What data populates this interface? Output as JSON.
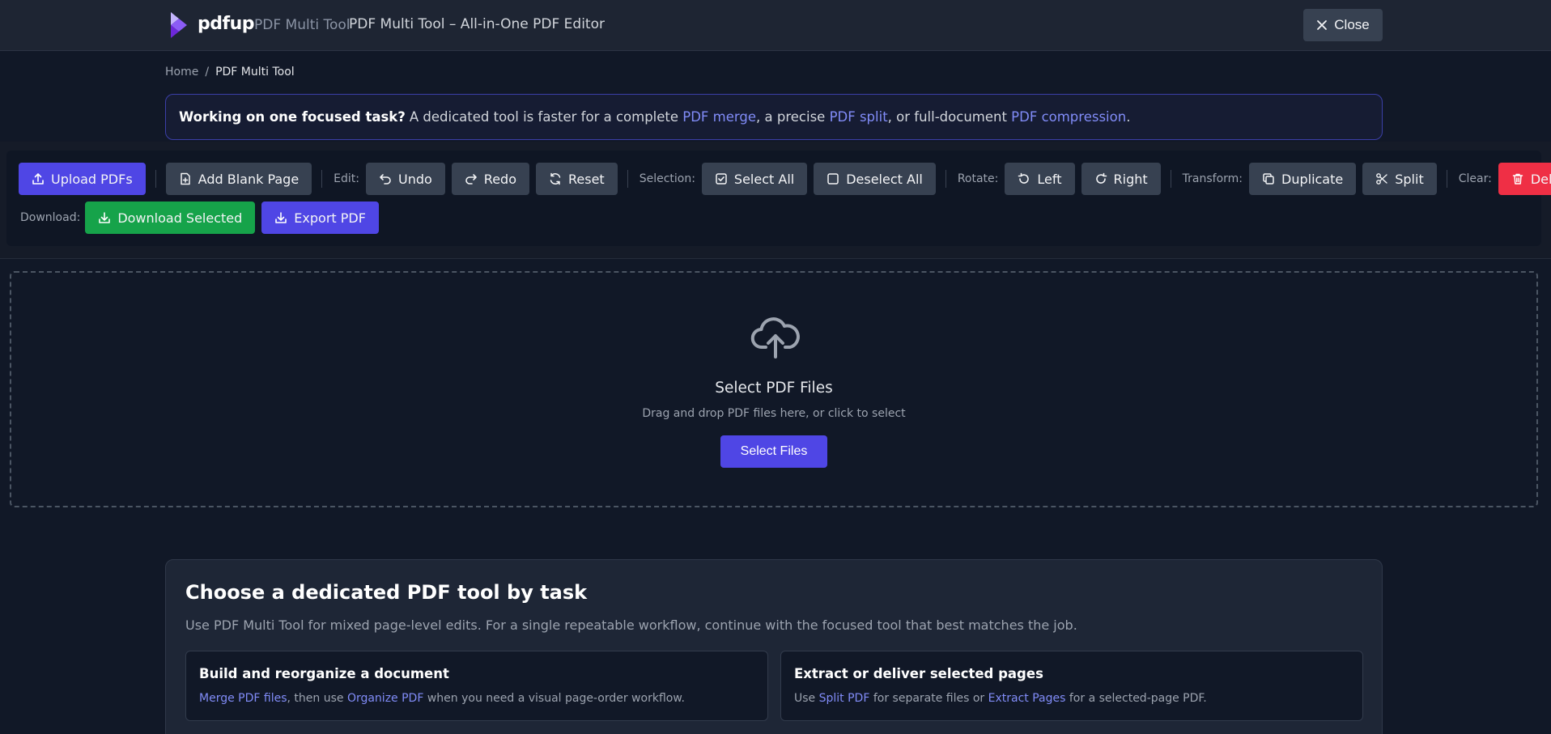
{
  "header": {
    "brand": "pdfup",
    "brand_sub": "PDF Multi Tool",
    "title": "PDF Multi Tool – All-in-One PDF Editor",
    "close_label": "Close"
  },
  "breadcrumb": {
    "home": "Home",
    "separator": "/",
    "current": "PDF Multi Tool"
  },
  "notice": {
    "lead": "Working on one focused task?",
    "text1": "A dedicated tool is faster for a complete ",
    "link1": "PDF merge",
    "text2": ", a precise ",
    "link2": "PDF split",
    "text3": ", or full-document ",
    "link3": "PDF compression",
    "text4": "."
  },
  "toolbar": {
    "upload": "Upload PDFs",
    "add_blank": "Add Blank Page",
    "edit_label": "Edit:",
    "undo": "Undo",
    "redo": "Redo",
    "reset": "Reset",
    "selection_label": "Selection:",
    "select_all": "Select All",
    "deselect_all": "Deselect All",
    "rotate_label": "Rotate:",
    "left": "Left",
    "right": "Right",
    "transform_label": "Transform:",
    "duplicate": "Duplicate",
    "split": "Split",
    "clear_label": "Clear:",
    "delete": "Delete",
    "download_label": "Download:",
    "download_selected": "Download Selected",
    "export": "Export PDF"
  },
  "dropzone": {
    "icon": "cloud-upload-icon",
    "title": "Select PDF Files",
    "subtitle": "Drag and drop PDF files here, or click to select",
    "button": "Select Files"
  },
  "tools": {
    "title": "Choose a dedicated PDF tool by task",
    "description": "Use PDF Multi Tool for mixed page-level edits. For a single repeatable workflow, continue with the focused tool that best matches the job.",
    "cards": [
      {
        "title": "Build and reorganize a document",
        "link1": "Merge PDF files",
        "text1": ", then use ",
        "link2": "Organize PDF",
        "text2": " when you need a visual page-order workflow."
      },
      {
        "title": "Extract or deliver selected pages",
        "text0": "Use ",
        "link1": "Split PDF",
        "text1": " for separate files or ",
        "link2": "Extract Pages",
        "text2": " for a selected-page PDF."
      }
    ]
  },
  "colors": {
    "accent": "#4f46e5",
    "success": "#16a34a",
    "danger": "#ef2f45",
    "link": "#818cf8",
    "background": "#111827"
  }
}
